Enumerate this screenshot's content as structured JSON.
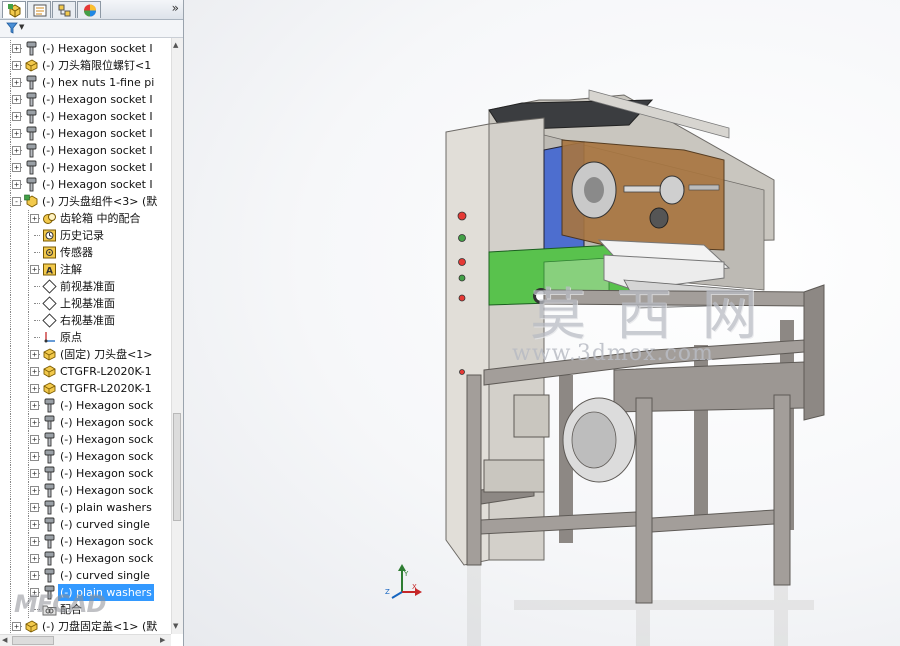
{
  "panel": {
    "tabs": [
      {
        "icon": "feature-manager-icon",
        "active": true
      },
      {
        "icon": "property-manager-icon",
        "active": false
      },
      {
        "icon": "configuration-manager-icon",
        "active": false
      },
      {
        "icon": "display-manager-icon",
        "active": false
      }
    ],
    "expand_glyph": "»",
    "filter_icon": "filter-icon"
  },
  "tree": {
    "items": [
      {
        "level": 0,
        "expand": "+",
        "icon": "bolt-icon",
        "label": "(-) Hexagon socket I"
      },
      {
        "level": 0,
        "expand": "+",
        "icon": "part-icon",
        "label": "(-) 刀头箱限位螺钉<1"
      },
      {
        "level": 0,
        "expand": "+",
        "icon": "bolt-icon",
        "label": "(-) hex nuts 1-fine pi"
      },
      {
        "level": 0,
        "expand": "+",
        "icon": "bolt-icon",
        "label": "(-) Hexagon socket I"
      },
      {
        "level": 0,
        "expand": "+",
        "icon": "bolt-icon",
        "label": "(-) Hexagon socket I"
      },
      {
        "level": 0,
        "expand": "+",
        "icon": "bolt-icon",
        "label": "(-) Hexagon socket I"
      },
      {
        "level": 0,
        "expand": "+",
        "icon": "bolt-icon",
        "label": "(-) Hexagon socket I"
      },
      {
        "level": 0,
        "expand": "+",
        "icon": "bolt-icon",
        "label": "(-) Hexagon socket I"
      },
      {
        "level": 0,
        "expand": "+",
        "icon": "bolt-icon",
        "label": "(-) Hexagon socket I"
      },
      {
        "level": 0,
        "expand": "-",
        "icon": "assembly-icon",
        "label": "(-) 刀头盘组件<3> (默"
      },
      {
        "level": 1,
        "expand": "+",
        "icon": "mate-icon",
        "label": "齿轮箱 中的配合"
      },
      {
        "level": 1,
        "expand": "",
        "icon": "history-icon",
        "label": "历史记录"
      },
      {
        "level": 1,
        "expand": "",
        "icon": "sensor-icon",
        "label": "传感器"
      },
      {
        "level": 1,
        "expand": "+",
        "icon": "annotation-icon",
        "label": "注解"
      },
      {
        "level": 1,
        "expand": "",
        "icon": "plane-icon",
        "label": "前视基准面"
      },
      {
        "level": 1,
        "expand": "",
        "icon": "plane-icon",
        "label": "上视基准面"
      },
      {
        "level": 1,
        "expand": "",
        "icon": "plane-icon",
        "label": "右视基准面"
      },
      {
        "level": 1,
        "expand": "",
        "icon": "origin-icon",
        "label": "原点"
      },
      {
        "level": 1,
        "expand": "+",
        "icon": "part-icon",
        "label": "(固定) 刀头盘<1>"
      },
      {
        "level": 1,
        "expand": "+",
        "icon": "part-icon",
        "label": "CTGFR-L2020K-1"
      },
      {
        "level": 1,
        "expand": "+",
        "icon": "part-icon",
        "label": "CTGFR-L2020K-1"
      },
      {
        "level": 1,
        "expand": "+",
        "icon": "bolt-icon",
        "label": "(-) Hexagon sock"
      },
      {
        "level": 1,
        "expand": "+",
        "icon": "bolt-icon",
        "label": "(-) Hexagon sock"
      },
      {
        "level": 1,
        "expand": "+",
        "icon": "bolt-icon",
        "label": "(-) Hexagon sock"
      },
      {
        "level": 1,
        "expand": "+",
        "icon": "bolt-icon",
        "label": "(-) Hexagon sock"
      },
      {
        "level": 1,
        "expand": "+",
        "icon": "bolt-icon",
        "label": "(-) Hexagon sock"
      },
      {
        "level": 1,
        "expand": "+",
        "icon": "bolt-icon",
        "label": "(-) Hexagon sock"
      },
      {
        "level": 1,
        "expand": "+",
        "icon": "bolt-icon",
        "label": "(-) plain washers"
      },
      {
        "level": 1,
        "expand": "+",
        "icon": "bolt-icon",
        "label": "(-) curved single"
      },
      {
        "level": 1,
        "expand": "+",
        "icon": "bolt-icon",
        "label": "(-) Hexagon sock"
      },
      {
        "level": 1,
        "expand": "+",
        "icon": "bolt-icon",
        "label": "(-) Hexagon sock"
      },
      {
        "level": 1,
        "expand": "+",
        "icon": "bolt-icon",
        "label": "(-) curved single"
      },
      {
        "level": 1,
        "expand": "+",
        "icon": "bolt-icon",
        "label": "(-) plain washers",
        "selected": true
      },
      {
        "level": 1,
        "expand": "",
        "icon": "folder-icon",
        "label": "配合"
      },
      {
        "level": 0,
        "expand": "+",
        "icon": "part-icon",
        "label": "(-) 刀盘固定盖<1> (默"
      }
    ]
  },
  "viewport": {
    "watermark_cn": "莫 西 网",
    "watermark_url": "www.3dmox.com",
    "watermark_logo": "MFCAD",
    "triad": {
      "icon": "axis-triad-icon",
      "x_label": "X",
      "y_label": "Y",
      "z_label": "Z"
    }
  },
  "colors": {
    "selection": "#3399ff",
    "machine_body": "#dddbd5",
    "frame": "#a39e9a",
    "chuck_blue": "#4d6ecf",
    "green_part": "#59c24d",
    "wood_block": "#a8753f",
    "dark_top": "#3b3d40"
  }
}
